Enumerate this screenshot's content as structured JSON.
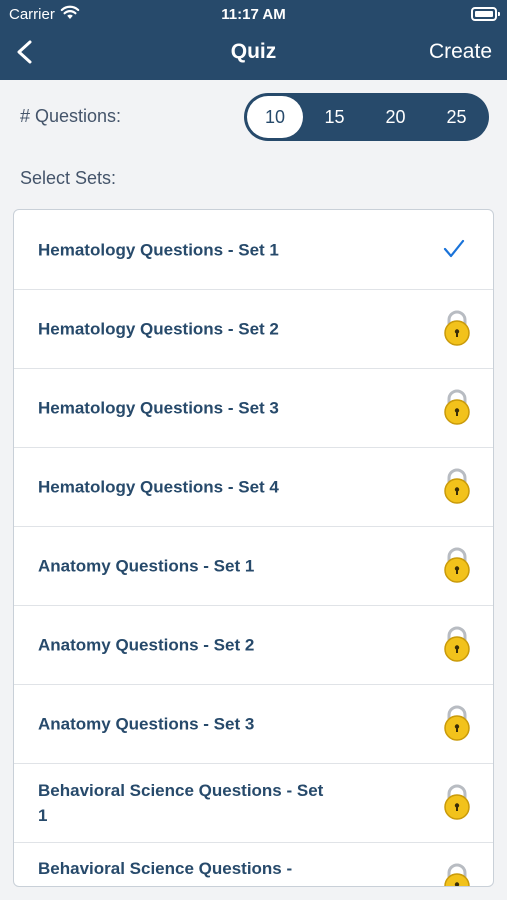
{
  "status_bar": {
    "carrier": "Carrier",
    "time": "11:17 AM"
  },
  "nav": {
    "title": "Quiz",
    "create_label": "Create"
  },
  "questions": {
    "label": "# Questions:",
    "options": [
      "10",
      "15",
      "20",
      "25"
    ],
    "selected": "10"
  },
  "sets": {
    "label": "Select Sets:",
    "items": [
      {
        "label": "Hematology Questions - Set 1",
        "status": "checked"
      },
      {
        "label": "Hematology Questions - Set 2",
        "status": "locked"
      },
      {
        "label": "Hematology Questions - Set 3",
        "status": "locked"
      },
      {
        "label": "Hematology Questions - Set 4",
        "status": "locked"
      },
      {
        "label": "Anatomy Questions - Set 1",
        "status": "locked"
      },
      {
        "label": "Anatomy Questions - Set 2",
        "status": "locked"
      },
      {
        "label": "Anatomy Questions - Set 3",
        "status": "locked"
      },
      {
        "label": "Behavioral Science Questions - Set 1",
        "status": "locked"
      },
      {
        "label": "Behavioral Science Questions -",
        "status": "locked"
      }
    ]
  },
  "colors": {
    "nav": "#274a6b",
    "accent": "#1a73d9",
    "lock": "#f2c21b"
  },
  "icons": {
    "back": "chevron-left-icon",
    "check": "checkmark-icon",
    "lock": "lock-icon",
    "wifi": "wifi-icon",
    "battery": "battery-icon"
  }
}
